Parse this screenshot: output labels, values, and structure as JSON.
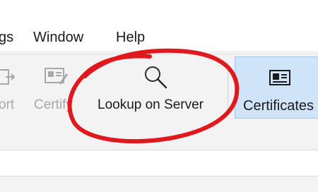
{
  "menubar": {
    "items": [
      {
        "label": "gs"
      },
      {
        "label": "Window"
      },
      {
        "label": "Help"
      }
    ]
  },
  "toolbar": {
    "export_label": "ort",
    "certify_label": "Certify",
    "lookup_label": "Lookup on Server",
    "certificates_label": "Certificates"
  },
  "colors": {
    "selected_background": "#cfe4f8",
    "annotation_stroke": "#e0191f",
    "disabled_text": "#a7a7a7"
  },
  "icons": {
    "export": "export-icon",
    "certify": "certify-icon",
    "lookup": "magnifier-icon",
    "certificates": "certificate-card-icon"
  }
}
